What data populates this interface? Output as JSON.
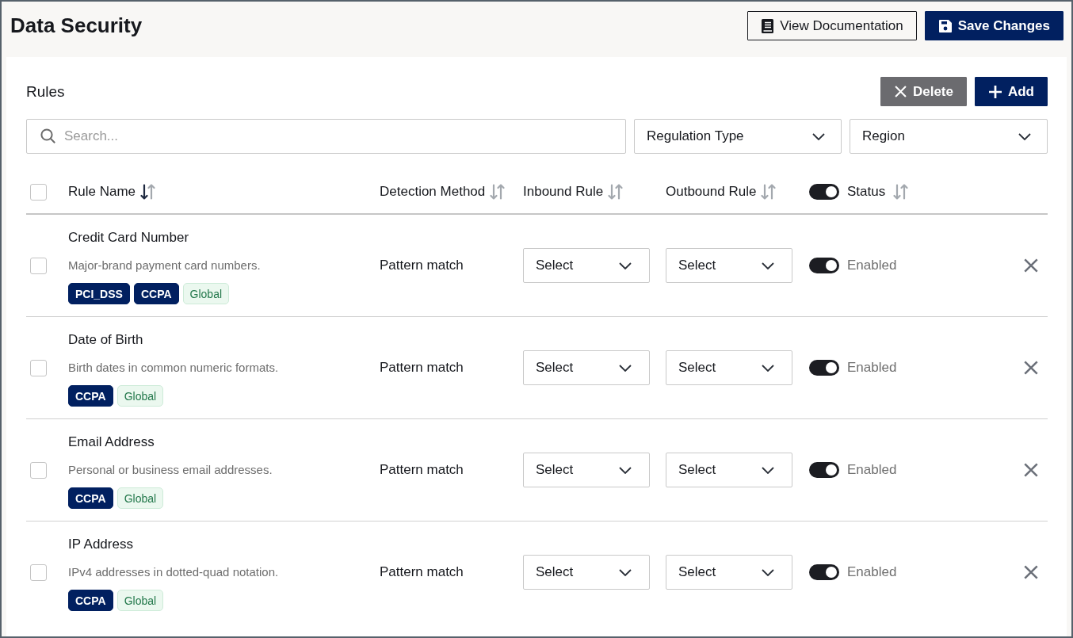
{
  "header": {
    "title": "Data Security",
    "actions": [
      {
        "kind": "outline",
        "label": "View Documentation"
      },
      {
        "kind": "primary",
        "label": "Save Changes"
      }
    ]
  },
  "rules": {
    "title": "Rules",
    "actions": [
      {
        "kind": "muted",
        "label": "Delete"
      },
      {
        "kind": "primary",
        "label": "Add"
      }
    ],
    "search": {
      "placeholder": "Search..."
    },
    "filters": [
      {
        "label": "Regulation Type"
      },
      {
        "label": "Region"
      }
    ],
    "table": {
      "select_all": {
        "checked": false
      },
      "columns": [
        {
          "label": "Rule Name",
          "sorted": true
        },
        {
          "label": "Detection Method",
          "sorted": false
        },
        {
          "label": "Inbound Rule",
          "sorted": false
        },
        {
          "label": "Outbound Rule",
          "sorted": false
        },
        {
          "label": "Status",
          "sorted": false,
          "toggle": {
            "on": true
          }
        }
      ],
      "rows": [
        {
          "checked": false,
          "name": "Credit Card Number",
          "description": "Major-brand payment card numbers.",
          "tags": [
            {
              "kind": "regulation",
              "label": "PCI_DSS"
            },
            {
              "kind": "regulation",
              "label": "CCPA"
            },
            {
              "kind": "region",
              "label": "Global"
            }
          ],
          "detection_method": "Pattern match",
          "inbound_rule": "Select",
          "outbound_rule": "Select",
          "enabled": true,
          "status": "Enabled"
        },
        {
          "checked": false,
          "name": "Date of Birth",
          "description": "Birth dates in common numeric formats.",
          "tags": [
            {
              "kind": "regulation",
              "label": "CCPA"
            },
            {
              "kind": "region",
              "label": "Global"
            }
          ],
          "detection_method": "Pattern match",
          "inbound_rule": "Select",
          "outbound_rule": "Select",
          "enabled": true,
          "status": "Enabled"
        },
        {
          "checked": false,
          "name": "Email Address",
          "description": "Personal or business email addresses.",
          "tags": [
            {
              "kind": "regulation",
              "label": "CCPA"
            },
            {
              "kind": "region",
              "label": "Global"
            }
          ],
          "detection_method": "Pattern match",
          "inbound_rule": "Select",
          "outbound_rule": "Select",
          "enabled": true,
          "status": "Enabled"
        },
        {
          "checked": false,
          "name": "IP Address",
          "description": "IPv4 addresses in dotted-quad notation.",
          "tags": [
            {
              "kind": "regulation",
              "label": "CCPA"
            },
            {
              "kind": "region",
              "label": "Global"
            }
          ],
          "detection_method": "Pattern match",
          "inbound_rule": "Select",
          "outbound_rule": "Select",
          "enabled": true,
          "status": "Enabled"
        }
      ]
    }
  }
}
